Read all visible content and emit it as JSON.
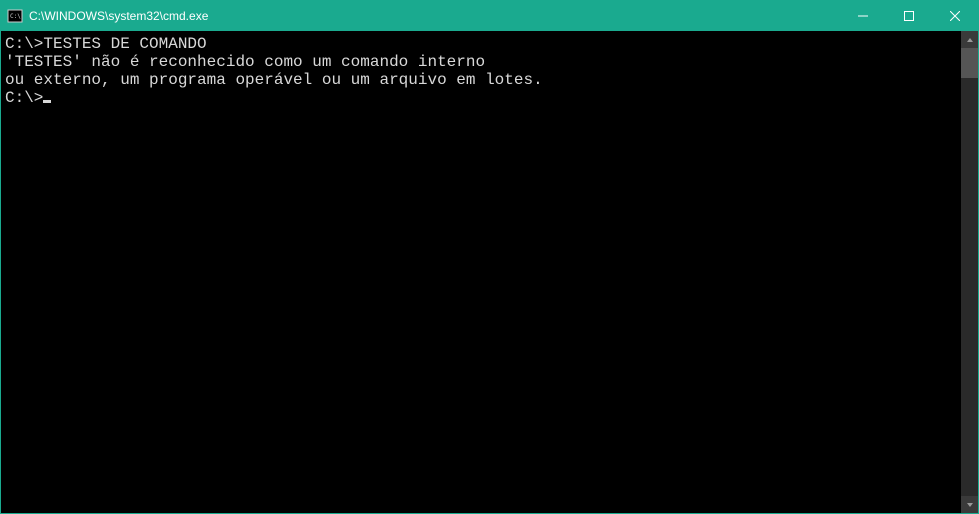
{
  "titlebar": {
    "title": "C:\\WINDOWS\\system32\\cmd.exe"
  },
  "terminal": {
    "lines": [
      "",
      "C:\\>TESTES DE COMANDO",
      "'TESTES' não é reconhecido como um comando interno",
      "ou externo, um programa operável ou um arquivo em lotes.",
      "",
      "C:\\>"
    ],
    "prompt_index_with_cursor": 5
  }
}
